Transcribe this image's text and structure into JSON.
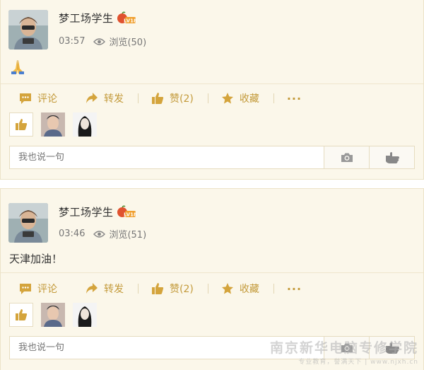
{
  "posts": [
    {
      "author": "梦工场学生",
      "level_badge": "LV18",
      "time": "03:57",
      "views_label": "浏览(50)",
      "content": "",
      "content_emoji": "praying-hands",
      "actions": {
        "comment": "评论",
        "share": "转发",
        "like": "赞(2)",
        "favorite": "收藏",
        "more": "···"
      },
      "comment_placeholder": "我也说一句"
    },
    {
      "author": "梦工场学生",
      "level_badge": "LV18",
      "time": "03:46",
      "views_label": "浏览(51)",
      "content": "天津加油！",
      "actions": {
        "comment": "评论",
        "share": "转发",
        "like": "赞(2)",
        "favorite": "收藏",
        "more": "···"
      },
      "comment_placeholder": "我也说一句"
    }
  ],
  "watermark": {
    "title": "南京新华电脑专修学院",
    "subtitle": "专业教育，誉满天下 | www.njxh.cn"
  },
  "colors": {
    "accent": "#c39a3a",
    "card_bg": "#fbf7ea",
    "border": "#e6dcc0"
  }
}
